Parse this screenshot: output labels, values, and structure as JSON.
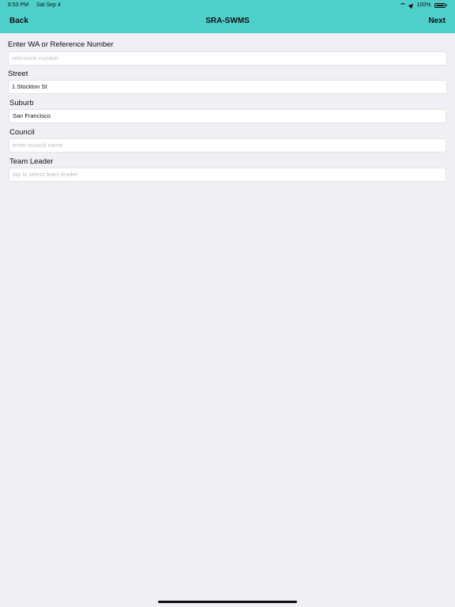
{
  "status_bar": {
    "time": "6:53 PM",
    "date": "Sat Sep 4",
    "battery": "100%",
    "icons": [
      "wifi-icon",
      "location-icon",
      "battery-icon"
    ]
  },
  "nav": {
    "back_label": "Back",
    "title": "SRA-SWMS",
    "next_label": "Next"
  },
  "form": {
    "reference": {
      "label": "Enter WA or Reference Number",
      "value": "",
      "placeholder": "reference number"
    },
    "street": {
      "label": "Street",
      "value": "1 Stockton St",
      "placeholder": ""
    },
    "suburb": {
      "label": "Suburb",
      "value": "San Francisco",
      "placeholder": ""
    },
    "council": {
      "label": "Council",
      "value": "",
      "placeholder": "enter council name"
    },
    "team_leader": {
      "label": "Team Leader",
      "value": "",
      "placeholder": "tap to select team leader"
    }
  },
  "colors": {
    "header_bg": "#4fcfcb",
    "page_bg": "#efeff4"
  }
}
